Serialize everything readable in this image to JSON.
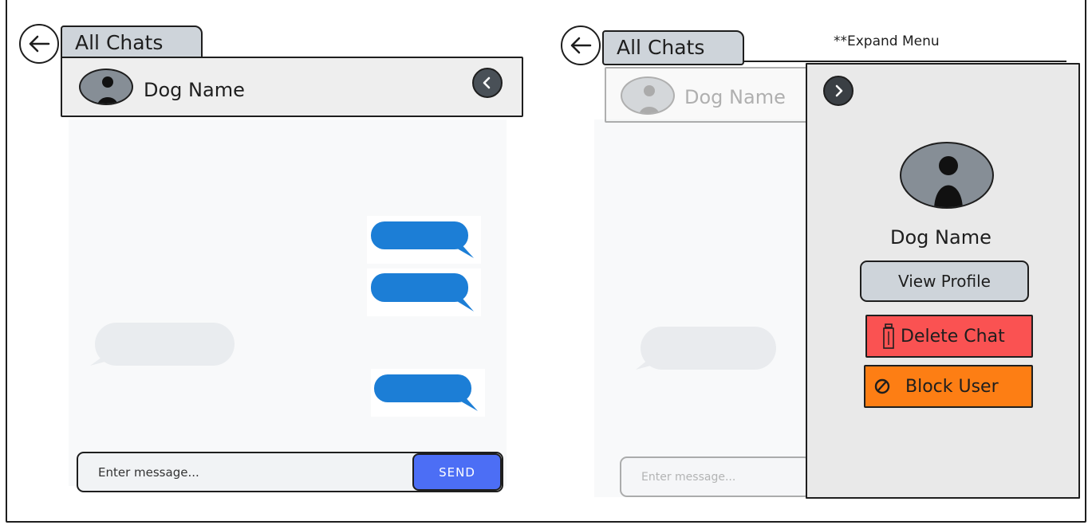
{
  "left_screen": {
    "back_label": "All Chats",
    "dog_name": "Dog Name",
    "input_placeholder": "Enter message...",
    "send_label": "SEND"
  },
  "right_screen": {
    "back_label": "All Chats",
    "dog_name": "Dog Name",
    "input_placeholder": "Enter message..."
  },
  "expand_note": "**Expand Menu",
  "expand_panel": {
    "dog_name": "Dog Name",
    "view_profile_label": "View Profile",
    "delete_label": "Delete Chat",
    "block_label": "Block User"
  },
  "colors": {
    "sent_bubble": "#1c7ed6",
    "received_bubble": "#e9ecef",
    "send_button": "#4c6ef5",
    "delete_button": "#fa5252",
    "block_button": "#fd7e14",
    "tab": "#ced4da",
    "avatar": "#868e96"
  },
  "icons": [
    "back-arrow-icon",
    "chevron-left-icon",
    "chevron-right-icon",
    "person-icon",
    "trash-icon",
    "ban-icon"
  ]
}
